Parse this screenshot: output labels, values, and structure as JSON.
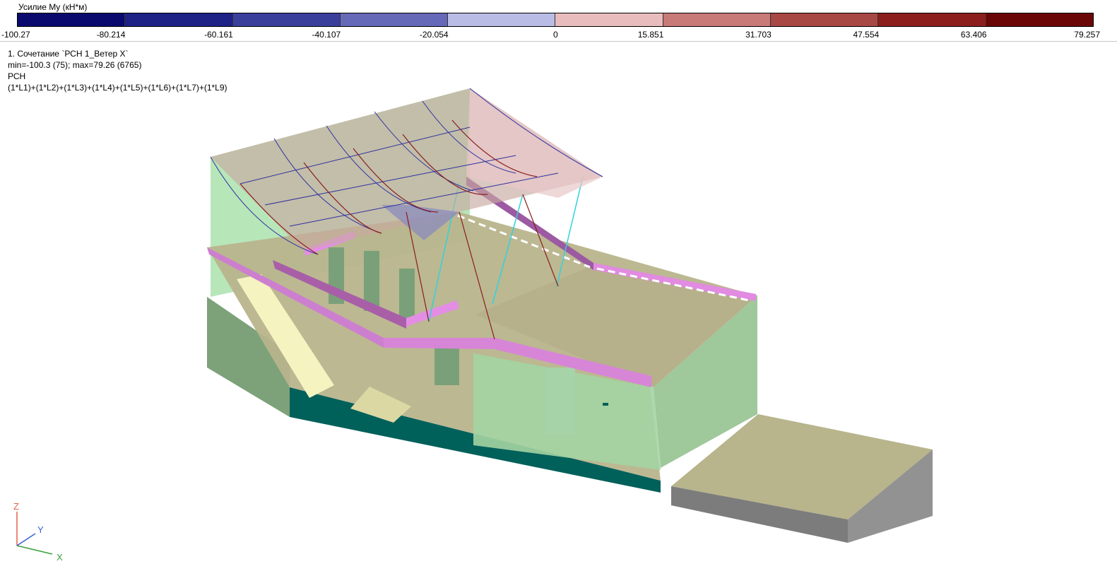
{
  "legend": {
    "title": "Усилие My (кН*м)",
    "colors": [
      "#0a0a6e",
      "#1e2186",
      "#3b3f9c",
      "#6669b8",
      "#b9bde6",
      "#e8bcbc",
      "#c87a78",
      "#a84845",
      "#8c1f1d",
      "#6b0606"
    ],
    "ticks": [
      "-100.27",
      "-80.214",
      "-60.161",
      "-40.107",
      "-20.054",
      "0",
      "15.851",
      "31.703",
      "47.554",
      "63.406",
      "79.257"
    ]
  },
  "info": {
    "line1": "1. Сочетание `РСН 1_Ветер X`",
    "line2": "min=-100.3 (75); max=79.26 (6765)",
    "line3": "РСН",
    "line4": "(1*L1)+(1*L2)+(1*L3)+(1*L4)+(1*L5)+(1*L6)+(1*L7)+(1*L9)"
  },
  "axes": {
    "z": "Z",
    "y": "Y",
    "x": "X"
  },
  "colors": {
    "wall_green": "#b4e6b8",
    "floor_khaki": "#b8b48c",
    "beam_pink": "#d98ad6",
    "base_teal": "#006058",
    "gray_block": "#8c8c8c",
    "diagram_red": "#b06060",
    "cable_cyan": "#29d6e0"
  }
}
